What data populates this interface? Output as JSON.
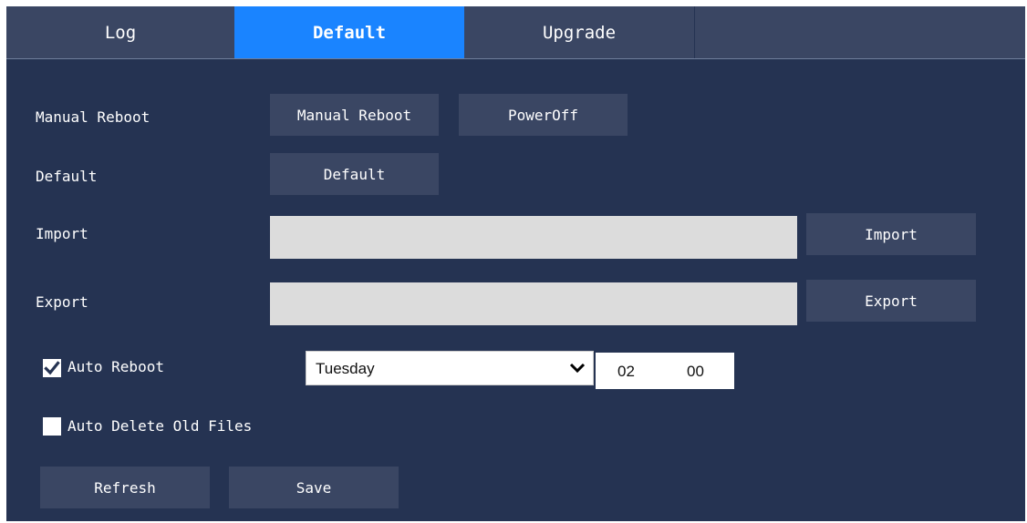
{
  "tabs": [
    {
      "label": "Log",
      "active": false
    },
    {
      "label": "Default",
      "active": true
    },
    {
      "label": "Upgrade",
      "active": false
    }
  ],
  "rows": {
    "manual_reboot": {
      "label": "Manual Reboot",
      "reboot_button": "Manual Reboot",
      "poweroff_button": "PowerOff"
    },
    "default": {
      "label": "Default",
      "button": "Default"
    },
    "import": {
      "label": "Import",
      "field_value": "",
      "button": "Import"
    },
    "export": {
      "label": "Export",
      "field_value": "",
      "button": "Export"
    },
    "auto_reboot": {
      "label": "Auto Reboot",
      "checked": true,
      "day": "Tuesday",
      "hour": "02",
      "minute": "00"
    },
    "auto_delete": {
      "label": "Auto Delete Old Files",
      "checked": false
    }
  },
  "footer": {
    "refresh_label": "Refresh",
    "save_label": "Save"
  },
  "colors": {
    "panel_bg": "#253352",
    "button_bg": "#3a4663",
    "active_tab": "#1a84ff",
    "field_bg": "#dcdcdc",
    "text": "#ffffff"
  },
  "icons": {
    "dropdown": "chevron-down-icon",
    "checkbox_checked": "checkmark-icon"
  }
}
